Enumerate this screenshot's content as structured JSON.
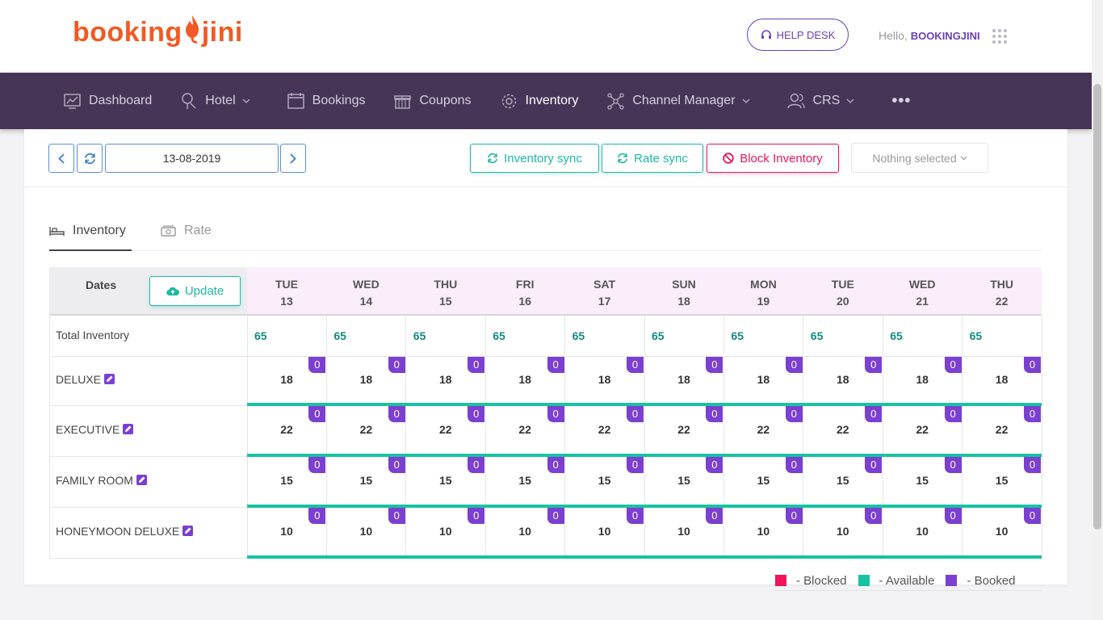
{
  "brand": {
    "name_left": "booking",
    "name_right": "jini",
    "color": "#f15a24"
  },
  "header": {
    "help_desk_label": "HELP DESK",
    "greeting": "Hello,",
    "user_name": "BOOKINGJINI"
  },
  "nav": {
    "items": [
      {
        "label": "Dashboard",
        "icon": "chart-icon"
      },
      {
        "label": "Hotel",
        "icon": "hotel-icon",
        "dropdown": true
      },
      {
        "label": "Bookings",
        "icon": "calendar-icon"
      },
      {
        "label": "Coupons",
        "icon": "gift-icon"
      },
      {
        "label": "Inventory",
        "icon": "gear-icon",
        "active": true
      },
      {
        "label": "Channel Manager",
        "icon": "network-icon",
        "dropdown": true
      },
      {
        "label": "CRS",
        "icon": "users-icon",
        "dropdown": true
      }
    ],
    "more_label": "•••"
  },
  "toolbar": {
    "date": "13-08-2019",
    "inventory_sync_label": "Inventory sync",
    "rate_sync_label": "Rate sync",
    "block_inventory_label": "Block Inventory",
    "select_placeholder": "Nothing selected"
  },
  "tabs": [
    {
      "label": "Inventory",
      "active": true
    },
    {
      "label": "Rate",
      "active": false
    }
  ],
  "grid": {
    "dates_label": "Dates",
    "update_label": "Update",
    "days": [
      {
        "dow": "TUE",
        "day": "13"
      },
      {
        "dow": "WED",
        "day": "14"
      },
      {
        "dow": "THU",
        "day": "15"
      },
      {
        "dow": "FRI",
        "day": "16"
      },
      {
        "dow": "SAT",
        "day": "17"
      },
      {
        "dow": "SUN",
        "day": "18"
      },
      {
        "dow": "MON",
        "day": "19"
      },
      {
        "dow": "TUE",
        "day": "20"
      },
      {
        "dow": "WED",
        "day": "21"
      },
      {
        "dow": "THU",
        "day": "22"
      }
    ],
    "total_label": "Total Inventory",
    "totals": [
      "65",
      "65",
      "65",
      "65",
      "65",
      "65",
      "65",
      "65",
      "65",
      "65"
    ],
    "rooms": [
      {
        "name": "DELUXE",
        "counts": [
          "18",
          "18",
          "18",
          "18",
          "18",
          "18",
          "18",
          "18",
          "18",
          "18"
        ],
        "booked": [
          "0",
          "0",
          "0",
          "0",
          "0",
          "0",
          "0",
          "0",
          "0",
          "0"
        ]
      },
      {
        "name": "EXECUTIVE",
        "counts": [
          "22",
          "22",
          "22",
          "22",
          "22",
          "22",
          "22",
          "22",
          "22",
          "22"
        ],
        "booked": [
          "0",
          "0",
          "0",
          "0",
          "0",
          "0",
          "0",
          "0",
          "0",
          "0"
        ]
      },
      {
        "name": "FAMILY ROOM",
        "counts": [
          "15",
          "15",
          "15",
          "15",
          "15",
          "15",
          "15",
          "15",
          "15",
          "15"
        ],
        "booked": [
          "0",
          "0",
          "0",
          "0",
          "0",
          "0",
          "0",
          "0",
          "0",
          "0"
        ]
      },
      {
        "name": "HONEYMOON DELUXE",
        "counts": [
          "10",
          "10",
          "10",
          "10",
          "10",
          "10",
          "10",
          "10",
          "10",
          "10"
        ],
        "booked": [
          "0",
          "0",
          "0",
          "0",
          "0",
          "0",
          "0",
          "0",
          "0",
          "0"
        ]
      }
    ]
  },
  "legend": [
    {
      "label": "- Blocked",
      "color": "#f0145a"
    },
    {
      "label": "- Available",
      "color": "#18c2a3"
    },
    {
      "label": "- Booked",
      "color": "#7b3fd1"
    }
  ],
  "colors": {
    "nav_bg": "#463557",
    "accent_purple": "#6a3fbe",
    "teal": "#1cb9a0",
    "pink": "#e8175d"
  }
}
